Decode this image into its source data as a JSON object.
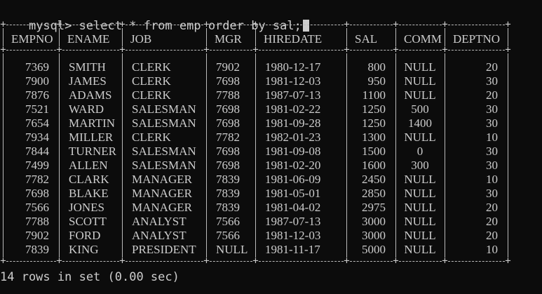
{
  "prompt": {
    "text": "mysql> select * from emp order by sal;"
  },
  "table": {
    "headers": [
      "EMPNO",
      "ENAME",
      "JOB",
      "MGR",
      "HIREDATE",
      "SAL",
      "COMM",
      "DEPTNO"
    ],
    "rows": [
      [
        "7369",
        "SMITH",
        "CLERK",
        "7902",
        "1980-12-17",
        "800",
        "NULL",
        "20"
      ],
      [
        "7900",
        "JAMES",
        "CLERK",
        "7698",
        "1981-12-03",
        "950",
        "NULL",
        "30"
      ],
      [
        "7876",
        "ADAMS",
        "CLERK",
        "7788",
        "1987-07-13",
        "1100",
        "NULL",
        "20"
      ],
      [
        "7521",
        "WARD",
        "SALESMAN",
        "7698",
        "1981-02-22",
        "1250",
        "500",
        "30"
      ],
      [
        "7654",
        "MARTIN",
        "SALESMAN",
        "7698",
        "1981-09-28",
        "1250",
        "1400",
        "30"
      ],
      [
        "7934",
        "MILLER",
        "CLERK",
        "7782",
        "1982-01-23",
        "1300",
        "NULL",
        "10"
      ],
      [
        "7844",
        "TURNER",
        "SALESMAN",
        "7698",
        "1981-09-08",
        "1500",
        "0",
        "30"
      ],
      [
        "7499",
        "ALLEN",
        "SALESMAN",
        "7698",
        "1981-02-20",
        "1600",
        "300",
        "30"
      ],
      [
        "7782",
        "CLARK",
        "MANAGER",
        "7839",
        "1981-06-09",
        "2450",
        "NULL",
        "10"
      ],
      [
        "7698",
        "BLAKE",
        "MANAGER",
        "7839",
        "1981-05-01",
        "2850",
        "NULL",
        "30"
      ],
      [
        "7566",
        "JONES",
        "MANAGER",
        "7839",
        "1981-04-02",
        "2975",
        "NULL",
        "20"
      ],
      [
        "7788",
        "SCOTT",
        "ANALYST",
        "7566",
        "1987-07-13",
        "3000",
        "NULL",
        "20"
      ],
      [
        "7902",
        "FORD",
        "ANALYST",
        "7566",
        "1981-12-03",
        "3000",
        "NULL",
        "20"
      ],
      [
        "7839",
        "KING",
        "PRESIDENT",
        "NULL",
        "1981-11-17",
        "5000",
        "NULL",
        "10"
      ]
    ]
  },
  "footer": {
    "text": "14 rows in set (0.00 sec)"
  },
  "colors": {
    "background": "#0c0c0c",
    "foreground": "#cccccc"
  }
}
